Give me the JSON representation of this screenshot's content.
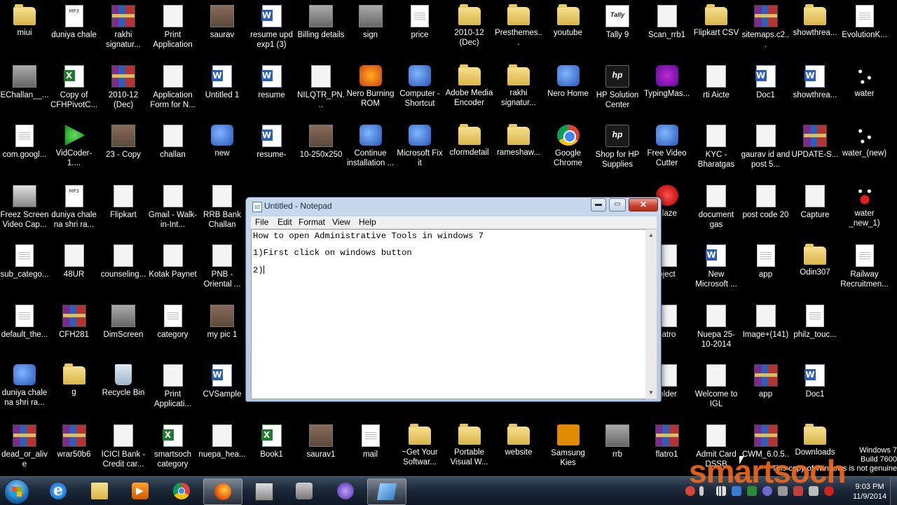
{
  "desktop": {
    "icons": [
      {
        "label": "miui",
        "kind": "folder"
      },
      {
        "label": "duniya chale",
        "kind": "mp3"
      },
      {
        "label": "rakhi signatur...",
        "kind": "rar"
      },
      {
        "label": "Print Application",
        "kind": "white"
      },
      {
        "label": "saurav",
        "kind": "photo"
      },
      {
        "label": "resume upd exp1 (3)",
        "kind": "word"
      },
      {
        "label": "Billing details",
        "kind": "gray"
      },
      {
        "label": "sign",
        "kind": "gray"
      },
      {
        "label": "price",
        "kind": "doc"
      },
      {
        "label": "2010-12 (Dec)",
        "kind": "folder"
      },
      {
        "label": "Presthemes...",
        "kind": "folder"
      },
      {
        "label": "youtube",
        "kind": "folder"
      },
      {
        "label": "Tally 9",
        "kind": "tally"
      },
      {
        "label": "Scan_rrb1",
        "kind": "white"
      },
      {
        "label": "Flipkart CSV",
        "kind": "folder"
      },
      {
        "label": "sitemaps.c2...",
        "kind": "rar"
      },
      {
        "label": "showthrea...",
        "kind": "folder"
      },
      {
        "label": "EvolutionK...",
        "kind": "doc"
      },
      {
        "label": "EChallan__...",
        "kind": "gray"
      },
      {
        "label": "Copy of CFHPivotC...",
        "kind": "excel"
      },
      {
        "label": "2010-12 (Dec)",
        "kind": "rar"
      },
      {
        "label": "Application Form for N...",
        "kind": "white"
      },
      {
        "label": "Untitled 1",
        "kind": "word"
      },
      {
        "label": "resume",
        "kind": "word"
      },
      {
        "label": "NILQTR_PN...",
        "kind": "white"
      },
      {
        "label": "Nero Burning ROM",
        "kind": "orange"
      },
      {
        "label": "Computer - Shortcut",
        "kind": "app"
      },
      {
        "label": "Adobe Media Encoder CS...",
        "kind": "folder"
      },
      {
        "label": "rakhi signatur...",
        "kind": "folder"
      },
      {
        "label": "Nero Home",
        "kind": "app"
      },
      {
        "label": "HP Solution Center",
        "kind": "hp"
      },
      {
        "label": "TypingMas...",
        "kind": "purple"
      },
      {
        "label": "rti Aicte",
        "kind": "white"
      },
      {
        "label": "Doc1",
        "kind": "word"
      },
      {
        "label": "showthrea...",
        "kind": "word"
      },
      {
        "label": "water",
        "kind": "drops"
      },
      {
        "label": "com.googl...",
        "kind": "doc"
      },
      {
        "label": "VidCoder-1....",
        "kind": "green"
      },
      {
        "label": "23 - Copy",
        "kind": "photo"
      },
      {
        "label": "challan",
        "kind": "white"
      },
      {
        "label": "new",
        "kind": "app"
      },
      {
        "label": "resume-",
        "kind": "word"
      },
      {
        "label": "10-250x250",
        "kind": "photo"
      },
      {
        "label": "Continue installation ...",
        "kind": "app"
      },
      {
        "label": "Microsoft Fix it",
        "kind": "app"
      },
      {
        "label": "cformdetail",
        "kind": "folder"
      },
      {
        "label": "rameshaw...",
        "kind": "folder"
      },
      {
        "label": "Google Chrome",
        "kind": "chrome"
      },
      {
        "label": "Shop for HP Supplies",
        "kind": "hp"
      },
      {
        "label": "Free Video Cutter",
        "kind": "app"
      },
      {
        "label": "KYC - Bharatgas",
        "kind": "white"
      },
      {
        "label": "gaurav id and post 5...",
        "kind": "white"
      },
      {
        "label": "UPDATE-S...",
        "kind": "rar"
      },
      {
        "label": "water_(new)",
        "kind": "drops"
      },
      {
        "label": "Freez Screen Video Cap...",
        "kind": "setup"
      },
      {
        "label": "duniya chale na shri ra...",
        "kind": "mp3"
      },
      {
        "label": "Flipkart",
        "kind": "white"
      },
      {
        "label": "Gmail - Walk-in-Int...",
        "kind": "white"
      },
      {
        "label": "RRB Bank Challan",
        "kind": "white"
      },
      {
        "label": "Blaze",
        "kind": "red"
      },
      {
        "label": "document gas",
        "kind": "white"
      },
      {
        "label": "post code 20",
        "kind": "white"
      },
      {
        "label": "Capture",
        "kind": "white"
      },
      {
        "label": "water _new_1)",
        "kind": "redwave"
      },
      {
        "label": "sub_catego...",
        "kind": "doc"
      },
      {
        "label": "48UR",
        "kind": "white"
      },
      {
        "label": "counseling...",
        "kind": "white"
      },
      {
        "label": "Kotak Paynet",
        "kind": "white"
      },
      {
        "label": "PNB -Oriental ...",
        "kind": "white"
      },
      {
        "label": "oject",
        "kind": "white"
      },
      {
        "label": "New Microsoft ...",
        "kind": "word"
      },
      {
        "label": "app",
        "kind": "doc"
      },
      {
        "label": "Odin307",
        "kind": "folder"
      },
      {
        "label": "Railway Recruitmen...",
        "kind": "doc"
      },
      {
        "label": "default_the...",
        "kind": "doc"
      },
      {
        "label": "CFH281",
        "kind": "rar"
      },
      {
        "label": "DimScreen",
        "kind": "gray"
      },
      {
        "label": "category",
        "kind": "doc"
      },
      {
        "label": "my pic 1",
        "kind": "photo"
      },
      {
        "label": "flatro",
        "kind": "white"
      },
      {
        "label": "Nuepa 25-10-2014",
        "kind": "white"
      },
      {
        "label": "Image+(141)",
        "kind": "white"
      },
      {
        "label": "philz_touc...",
        "kind": "doc"
      },
      {
        "label": "duniya chale na shri ra...",
        "kind": "app"
      },
      {
        "label": "g",
        "kind": "folder"
      },
      {
        "label": "Recycle Bin",
        "kind": "bin"
      },
      {
        "label": "Print Applicati...",
        "kind": "white"
      },
      {
        "label": "CVSample",
        "kind": "word"
      },
      {
        "label": "folder",
        "kind": "white"
      },
      {
        "label": "Welcome to IGL",
        "kind": "white"
      },
      {
        "label": "app",
        "kind": "rar"
      },
      {
        "label": "Doc1",
        "kind": "word"
      },
      {
        "label": "dead_or_alive",
        "kind": "rar"
      },
      {
        "label": "wrar50b6",
        "kind": "rar"
      },
      {
        "label": "ICICI Bank - Credit car...",
        "kind": "white"
      },
      {
        "label": "smartsoch category",
        "kind": "excel"
      },
      {
        "label": "nuepa_hea...",
        "kind": "white"
      },
      {
        "label": "Book1",
        "kind": "excel"
      },
      {
        "label": "saurav1",
        "kind": "photo"
      },
      {
        "label": "mail",
        "kind": "doc"
      },
      {
        "label": "~Get Your Softwar...",
        "kind": "folder"
      },
      {
        "label": "Portable Visual W...",
        "kind": "folder"
      },
      {
        "label": "website",
        "kind": "folder"
      },
      {
        "label": "Samsung Kies",
        "kind": "samsung"
      },
      {
        "label": "rrb",
        "kind": "gray"
      },
      {
        "label": "flatro1",
        "kind": "rar"
      },
      {
        "label": "Admit Card DSSB",
        "kind": "white"
      },
      {
        "label": "CWM_6.0.5....",
        "kind": "rar"
      },
      {
        "label": "Downloads",
        "kind": "folder"
      }
    ]
  },
  "notepad": {
    "title": "Untitled - Notepad",
    "menu": [
      "File",
      "Edit",
      "Format",
      "View",
      "Help"
    ],
    "lines": [
      "How to open Administrative Tools in windows 7",
      "1)First click on windows button",
      "2)"
    ],
    "buttons": {
      "minimize": "▬",
      "maximize": "▭",
      "close": "✕"
    }
  },
  "taskbar": {
    "pinned": [
      {
        "name": "ie",
        "active": false
      },
      {
        "name": "folder",
        "active": false
      },
      {
        "name": "media",
        "active": false
      },
      {
        "name": "chrome",
        "active": false
      },
      {
        "name": "firefox",
        "active": true
      },
      {
        "name": "window",
        "active": false
      },
      {
        "name": "camera",
        "active": false
      },
      {
        "name": "torrent",
        "active": false
      },
      {
        "name": "notepad",
        "active": true
      }
    ],
    "clock_time": "9:03 PM",
    "clock_date": "11/9/2014"
  },
  "overlay": {
    "os_line1": "Windows 7",
    "os_line2": "Build 7600",
    "os_line3": "This copy of Windows is not genuine",
    "logo_text": "smartsoch"
  },
  "colors": {
    "logo": "#f26a1b",
    "desktop": "#000000"
  }
}
